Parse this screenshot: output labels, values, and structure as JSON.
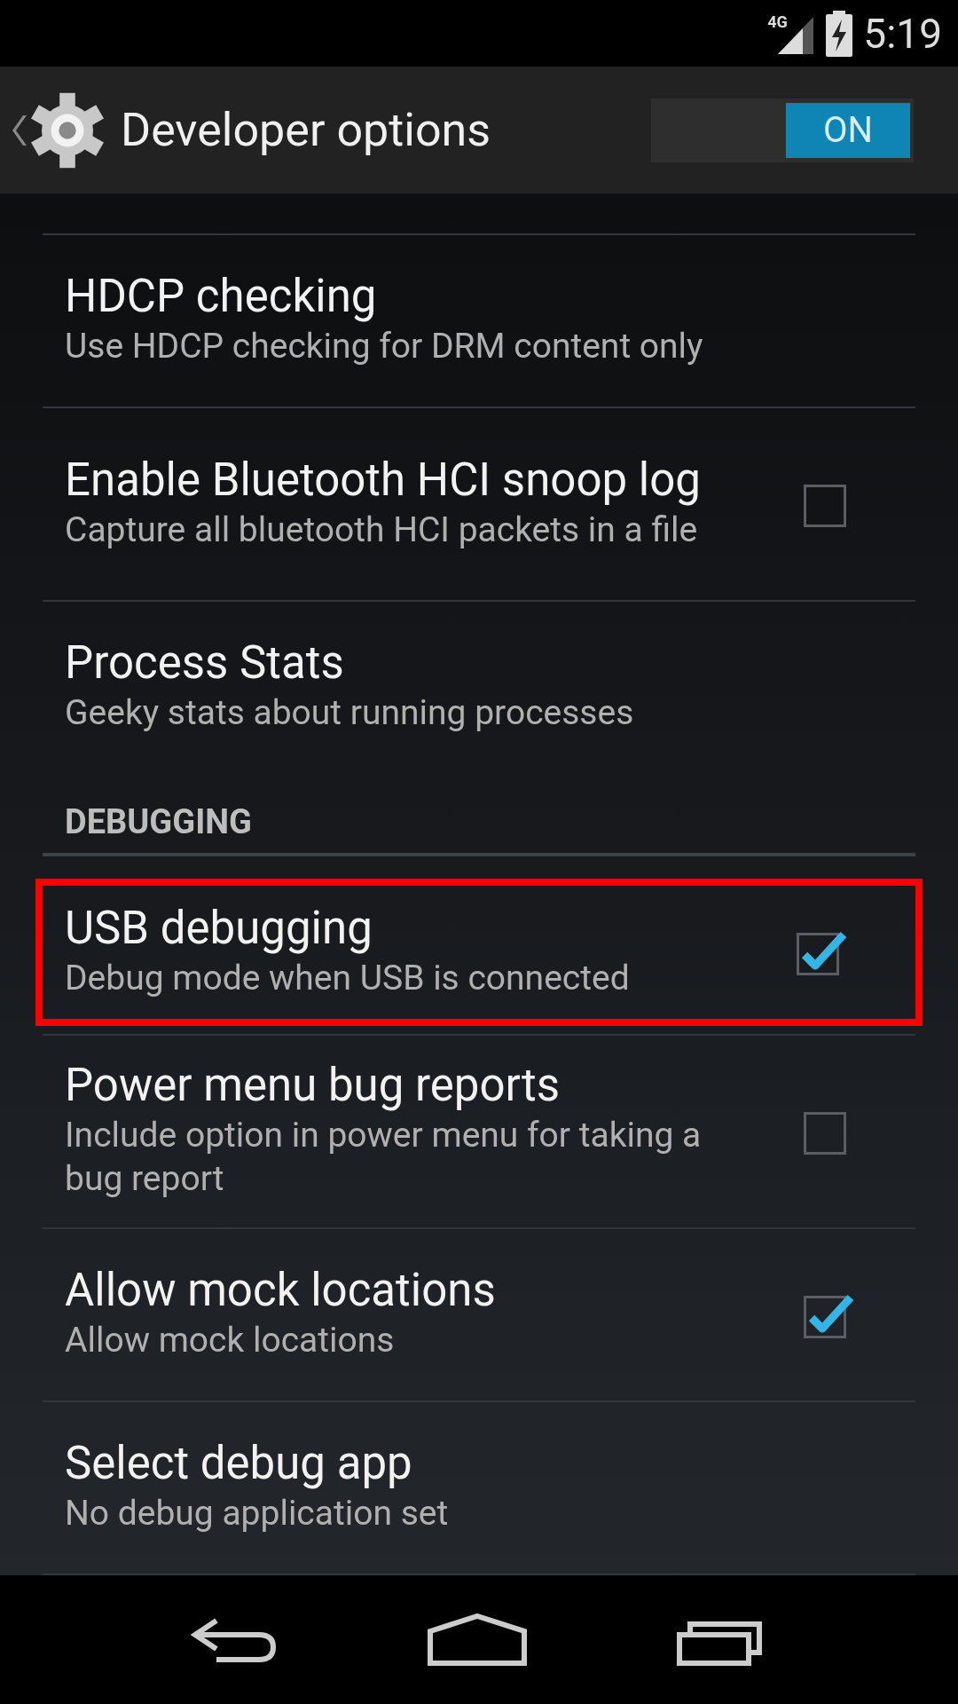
{
  "status_bar": {
    "network": "4G",
    "time": "5:19"
  },
  "action_bar": {
    "title": "Developer options",
    "master_switch": {
      "label": "ON",
      "on": true
    }
  },
  "items": [
    {
      "kind": "setting",
      "title": "HDCP checking",
      "summary": "Use HDCP checking for DRM content only",
      "highlighted": false
    },
    {
      "kind": "checkbox",
      "title": "Enable Bluetooth HCI snoop log",
      "summary": "Capture all bluetooth HCI packets in a file",
      "checked": false,
      "highlighted": false
    },
    {
      "kind": "setting",
      "title": "Process Stats",
      "summary": "Geeky stats about running processes",
      "highlighted": false
    },
    {
      "kind": "header",
      "title": "DEBUGGING"
    },
    {
      "kind": "checkbox",
      "title": "USB debugging",
      "summary": "Debug mode when USB is connected",
      "checked": true,
      "highlighted": true
    },
    {
      "kind": "checkbox",
      "title": "Power menu bug reports",
      "summary": "Include option in power menu for taking a bug report",
      "checked": false,
      "highlighted": false
    },
    {
      "kind": "checkbox",
      "title": "Allow mock locations",
      "summary": "Allow mock locations",
      "checked": true,
      "highlighted": false
    },
    {
      "kind": "setting",
      "title": "Select debug app",
      "summary": "No debug application set",
      "highlighted": false
    }
  ]
}
